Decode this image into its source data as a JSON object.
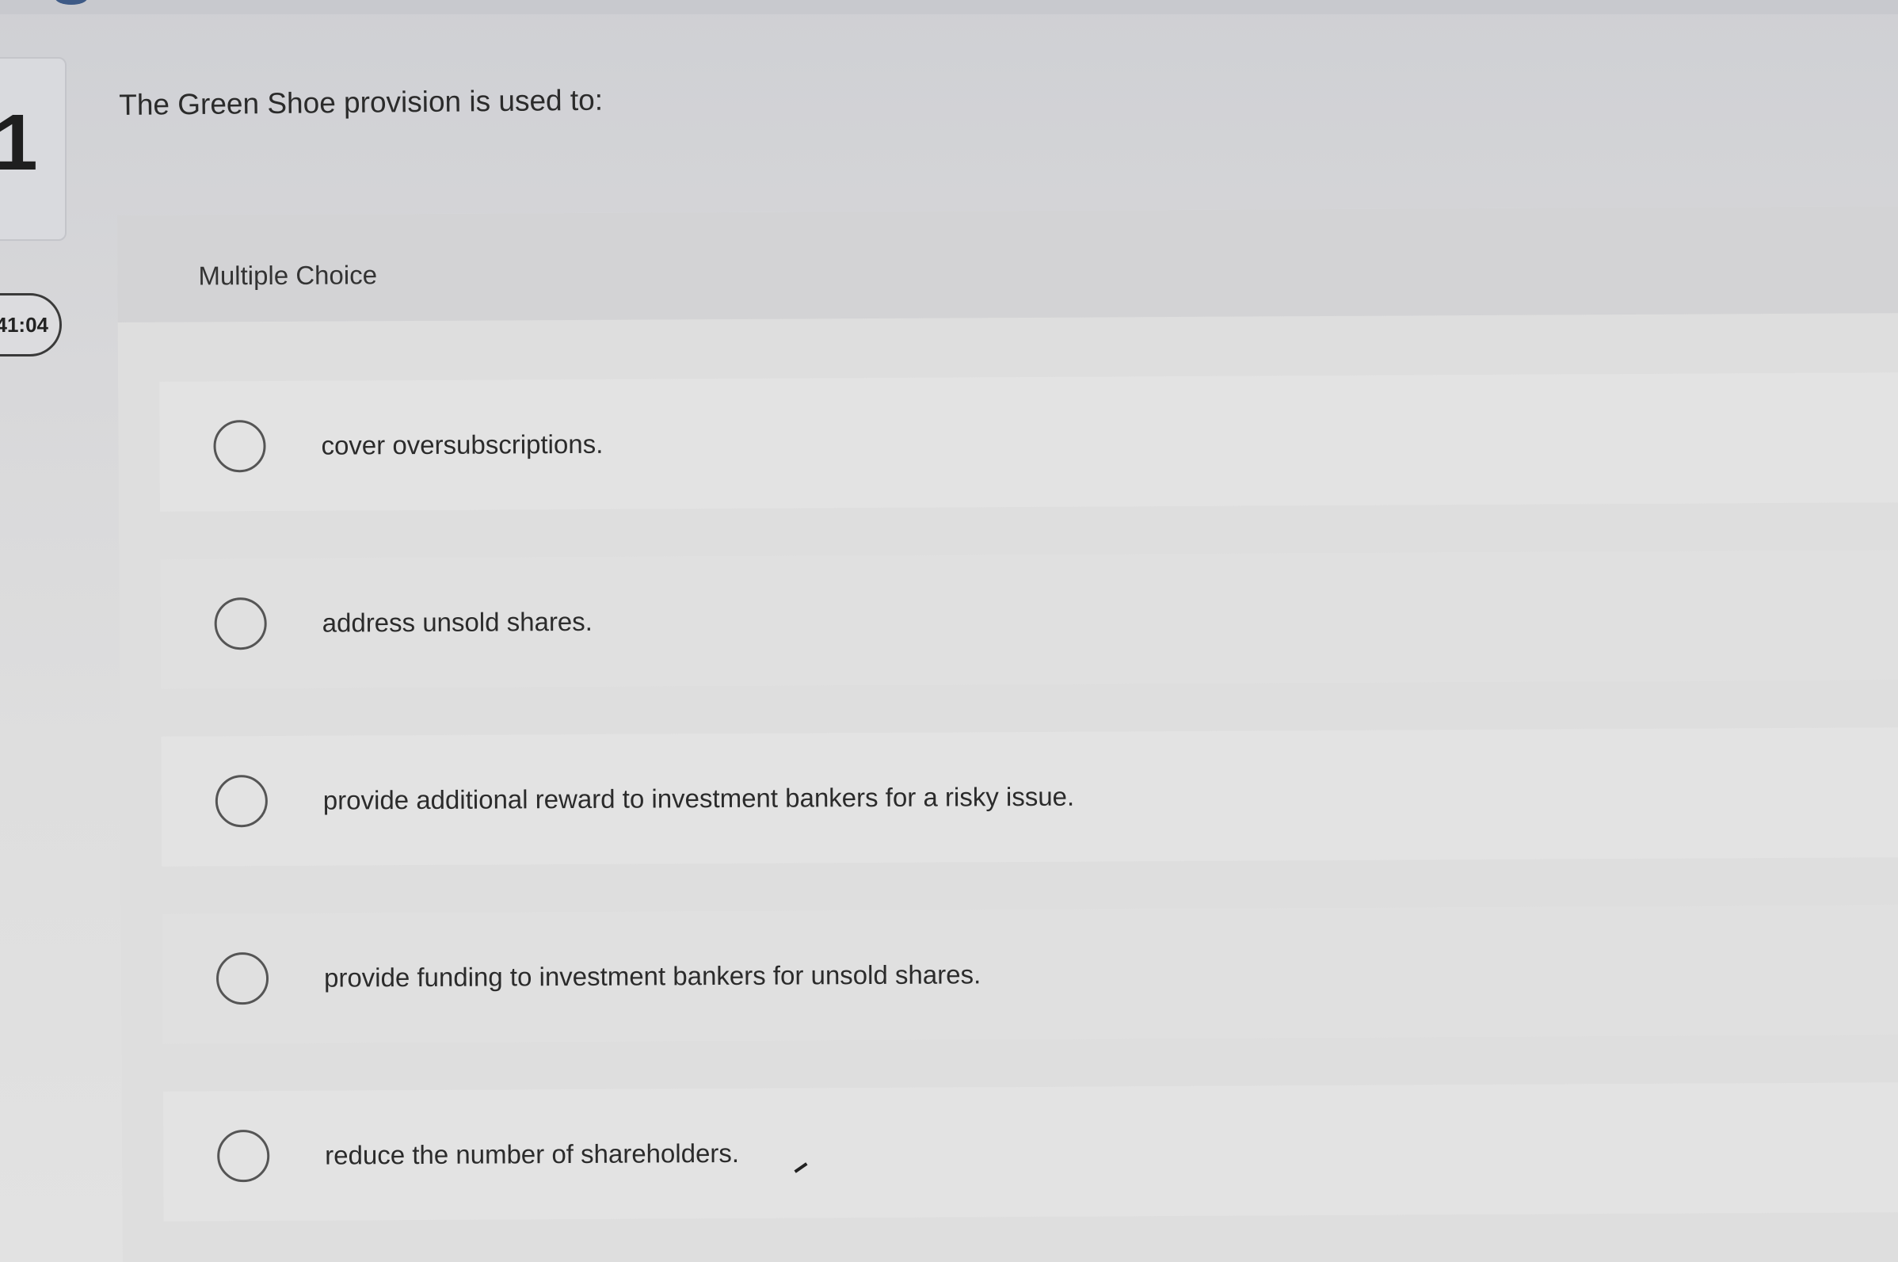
{
  "question": {
    "number": "1",
    "text": "The Green Shoe provision is used to:"
  },
  "timer": {
    "value": "41:04"
  },
  "answer_panel": {
    "type_label": "Multiple Choice",
    "options": [
      {
        "label": "cover oversubscriptions."
      },
      {
        "label": "address unsold shares."
      },
      {
        "label": "provide additional reward to investment bankers for a risky issue."
      },
      {
        "label": "provide funding to investment bankers for unsold shares."
      },
      {
        "label": "reduce the number of shareholders."
      }
    ]
  }
}
